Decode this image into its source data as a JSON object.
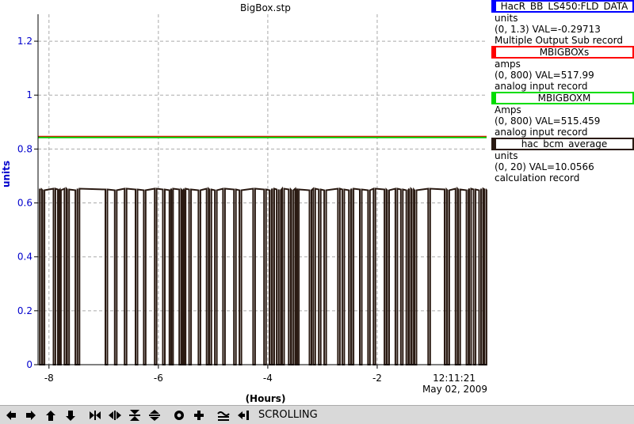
{
  "chart_data": {
    "type": "line",
    "title": "BigBox.stp",
    "xlabel": "(Hours)",
    "ylabel": "units",
    "xlim": [
      -8.2,
      0
    ],
    "ylim": [
      0,
      1.3
    ],
    "x_ticks": [
      -8,
      -6,
      -4,
      -2
    ],
    "x_tick_labels": [
      "-8",
      "-6",
      "-4",
      "-2"
    ],
    "y_ticks": [
      0,
      0.2,
      0.4,
      0.6,
      0.8,
      1,
      1.2
    ],
    "y_tick_labels": [
      "0",
      "0.2",
      "0.4",
      "0.6",
      "0.8",
      "1",
      "1.2"
    ],
    "time_label": "12:11:21",
    "date_label": "May 02, 2009",
    "grid": true,
    "series": [
      {
        "name": "MBIGBOXs",
        "color": "#ff0000",
        "constant": 0.843
      },
      {
        "name": "MBIGBOXM",
        "color": "#00cc00",
        "constant": 0.843
      },
      {
        "name": "hac_bcm_average",
        "color": "#2a1a12",
        "baseline": 0.65,
        "dropouts": [
          -8.15,
          -8.1,
          -7.9,
          -7.82,
          -7.8,
          -7.7,
          -7.65,
          -7.5,
          -7.46,
          -6.95,
          -6.78,
          -6.6,
          -6.4,
          -6.25,
          -6.05,
          -5.9,
          -5.78,
          -5.75,
          -5.6,
          -5.55,
          -5.52,
          -5.42,
          -5.25,
          -5.1,
          -5.05,
          -4.95,
          -4.8,
          -4.6,
          -4.5,
          -4.25,
          -4.05,
          -3.95,
          -3.9,
          -3.82,
          -3.78,
          -3.72,
          -3.6,
          -3.55,
          -3.48,
          -3.45,
          -3.22,
          -3.15,
          -3.05,
          -2.95,
          -2.7,
          -2.62,
          -2.5,
          -2.45,
          -2.3,
          -2.15,
          -2.05,
          -1.85,
          -1.8,
          -1.65,
          -1.55,
          -1.45,
          -1.4,
          -1.35,
          -1.3,
          -1.05,
          -0.75,
          -0.7,
          -0.55,
          -0.5,
          -0.35,
          -0.3,
          -0.22,
          -0.12,
          -0.08,
          -0.02
        ]
      }
    ]
  },
  "legend": [
    {
      "name": "HacR_BB_LS450:FLD_DATA",
      "color": "#0000ff",
      "units": "units",
      "range": "(0, 1.3) VAL=-0.29713",
      "record": "Multiple Output Sub record"
    },
    {
      "name": "MBIGBOXs",
      "color": "#ff0000",
      "units": "amps",
      "range": "(0, 800) VAL=517.99",
      "record": "analog input record"
    },
    {
      "name": "MBIGBOXM",
      "color": "#00dd00",
      "units": "Amps",
      "range": "(0, 800) VAL=515.459",
      "record": "analog input record"
    },
    {
      "name": "hac_bcm_average",
      "color": "#2a1a12",
      "units": "units",
      "range": "(0, 20) VAL=10.0566",
      "record": "calculation record"
    }
  ],
  "toolbar": {
    "buttons": [
      "arrow-left-icon",
      "arrow-right-icon",
      "arrow-up-icon",
      "arrow-down-icon",
      "compress-horizontal-icon",
      "expand-horizontal-icon",
      "compress-vertical-icon",
      "expand-vertical-icon",
      "circle-icon",
      "plus-icon",
      "scroll-wave-icon",
      "arrow-into-bar-icon"
    ],
    "status": "SCROLLING"
  }
}
